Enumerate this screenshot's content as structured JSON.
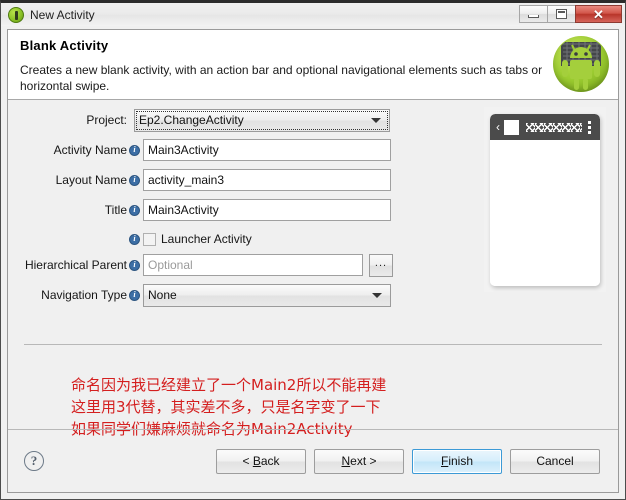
{
  "window": {
    "title": "New Activity",
    "icon": "android-circle-icon",
    "controls": {
      "minimize": "minimize-icon",
      "maximize": "maximize-icon",
      "close": "✕"
    }
  },
  "header": {
    "title": "Blank Activity",
    "description": "Creates a new blank activity, with an action bar and optional navigational elements such as tabs or horizontal swipe.",
    "logo": "android-robot-logo"
  },
  "form": {
    "rows": [
      {
        "label": "Project:",
        "value": "Ep2.ChangeActivity",
        "type": "combo",
        "info": false,
        "focused": true
      },
      {
        "label": "Activity Name",
        "value": "Main3Activity",
        "type": "text",
        "info": true
      },
      {
        "label": "Layout Name",
        "value": "activity_main3",
        "type": "text",
        "info": true
      },
      {
        "label": "Title",
        "value": "Main3Activity",
        "type": "text",
        "info": true
      },
      {
        "label": "",
        "value": "Launcher Activity",
        "type": "checkbox",
        "info": true,
        "checked": false
      },
      {
        "label": "Hierarchical Parent",
        "value": "",
        "placeholder": "Optional",
        "type": "text-browse",
        "info": true,
        "browse_label": "..."
      },
      {
        "label": "Navigation Type",
        "value": "None",
        "type": "combo",
        "info": true
      }
    ]
  },
  "preview": {
    "name": "activity-preview",
    "actionbar": {
      "back": "‹",
      "app_icon": "app-square-icon",
      "title_placeholder": "zigzag-title",
      "overflow": "overflow-menu-icon"
    }
  },
  "annotation": {
    "color": "#d41f1f",
    "lines": [
      "命名因为我已经建立了一个Main2所以不能再建",
      "这里用3代替，其实差不多，只是名字变了一下",
      "如果同学们嫌麻烦就命名为Main2Activity"
    ]
  },
  "buttonbar": {
    "help": "?",
    "back": "< Back",
    "back_mnemonic": "B",
    "next": "Next >",
    "next_mnemonic": "N",
    "finish": "Finish",
    "finish_mnemonic": "F",
    "cancel": "Cancel"
  }
}
